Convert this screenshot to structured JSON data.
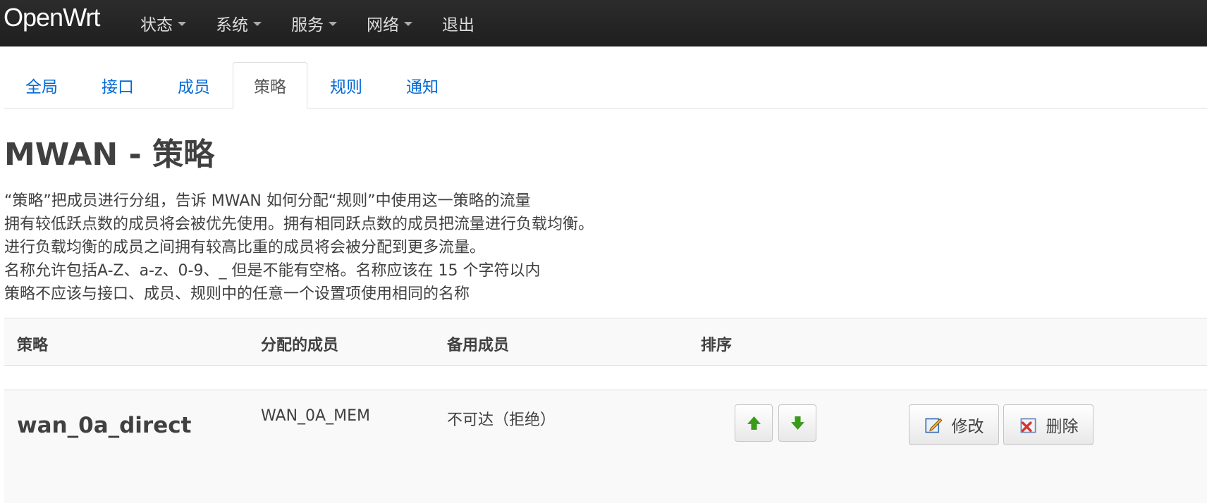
{
  "brand": "OpenWrt",
  "menu": [
    {
      "label": "状态"
    },
    {
      "label": "系统"
    },
    {
      "label": "服务"
    },
    {
      "label": "网络"
    },
    {
      "label": "退出"
    }
  ],
  "tabs": [
    {
      "label": "全局"
    },
    {
      "label": "接口"
    },
    {
      "label": "成员"
    },
    {
      "label": "策略",
      "active": true
    },
    {
      "label": "规则"
    },
    {
      "label": "通知"
    }
  ],
  "page": {
    "title": "MWAN - 策略",
    "description": [
      "“策略”把成员进行分组，告诉 MWAN 如何分配“规则”中使用这一策略的流量",
      "拥有较低跃点数的成员将会被优先使用。拥有相同跃点数的成员把流量进行负载均衡。",
      "进行负载均衡的成员之间拥有较高比重的成员将会被分配到更多流量。",
      "名称允许包括A-Z、a-z、0-9、_ 但是不能有空格。名称应该在 15 个字符以内",
      "策略不应该与接口、成员、规则中的任意一个设置项使用相同的名称"
    ]
  },
  "table": {
    "headers": [
      "策略",
      "分配的成员",
      "备用成员",
      "排序"
    ],
    "rows": [
      {
        "policy": "wan_0a_direct",
        "assigned_members": "WAN_0A_MEM",
        "fallback_members": "不可达（拒绝）",
        "edit_label": "修改",
        "delete_label": "删除"
      }
    ]
  },
  "colors": {
    "navbar": "#222222",
    "link": "#0069d6",
    "text": "#404040",
    "arrow_green": "#3a9a1a",
    "delete_red": "#d9342b"
  }
}
